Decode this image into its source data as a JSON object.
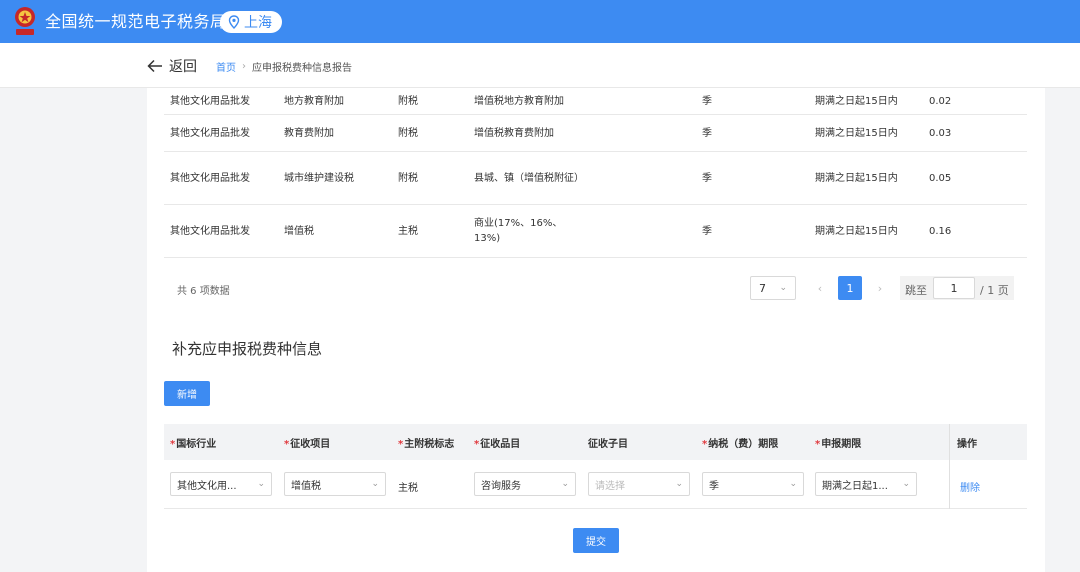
{
  "header": {
    "site_title": "全国统一规范电子税务局",
    "region": "上海",
    "accent": "#3d8bf2"
  },
  "nav": {
    "back_label": "返回",
    "breadcrumb": [
      "首页",
      "应申报税费种信息报告"
    ]
  },
  "top_table": {
    "rows": [
      {
        "industry": "其他文化用品批发",
        "item": "地方教育附加",
        "flag": "附税",
        "category": "增值税地方教育附加",
        "period": "季",
        "deadline": "期满之日起15日内",
        "rate": "0.02"
      },
      {
        "industry": "其他文化用品批发",
        "item": "教育费附加",
        "flag": "附税",
        "category": "增值税教育费附加",
        "period": "季",
        "deadline": "期满之日起15日内",
        "rate": "0.03"
      },
      {
        "industry": "其他文化用品批发",
        "item": "城市维护建设税",
        "flag": "附税",
        "category": "县城、镇（增值税附征）",
        "period": "季",
        "deadline": "期满之日起15日内",
        "rate": "0.05"
      },
      {
        "industry": "其他文化用品批发",
        "item": "增值税",
        "flag": "主税",
        "category": "商业(17%、16%、13%)",
        "period": "季",
        "deadline": "期满之日起15日内",
        "rate": "0.16"
      }
    ]
  },
  "pagination": {
    "total_text": "共 6 项数据",
    "page_size": "7",
    "prev": "‹",
    "current_page": "1",
    "next": "›",
    "jump_label": "跳至",
    "jump_value": "1",
    "total_pages": "/ 1 页"
  },
  "supplement": {
    "title": "补充应申报税费种信息",
    "add_label": "新增",
    "headers": {
      "industry": "国标行业",
      "item": "征收项目",
      "flag": "主附税标志",
      "category": "征收品目",
      "subcategory": "征收子目",
      "period": "纳税（费）期限",
      "deadline": "申报期限",
      "action": "操作"
    },
    "required_mark": "*",
    "row": {
      "industry": "其他文化用...",
      "item": "增值税",
      "flag": "主税",
      "category": "咨询服务",
      "subcategory_placeholder": "请选择",
      "period": "季",
      "deadline": "期满之日起1...",
      "delete_label": "删除"
    },
    "submit_label": "提交"
  }
}
